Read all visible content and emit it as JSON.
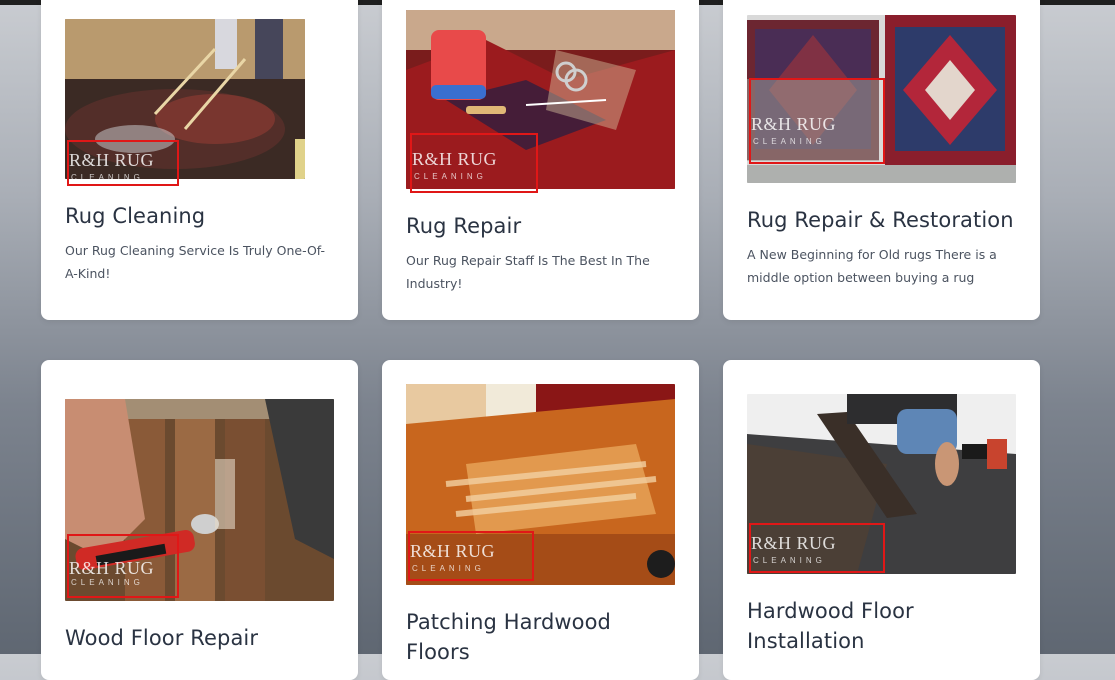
{
  "watermark": {
    "brand": "R&H RUG",
    "sub": "CLEANING"
  },
  "cards": [
    {
      "title": "Rug Cleaning",
      "description": "Our Rug Cleaning Service Is Truly One-Of-A-Kind!"
    },
    {
      "title": "Rug Repair",
      "description": "Our Rug Repair Staff Is The Best In The Industry!"
    },
    {
      "title": "Rug Repair & Restoration",
      "description": "A New Beginning for Old rugs There is a middle option between buying a rug"
    },
    {
      "title": "Wood Floor Repair",
      "description": ""
    },
    {
      "title": "Patching Hardwood Floors",
      "description": ""
    },
    {
      "title": "Hardwood Floor Installation",
      "description": ""
    }
  ],
  "colors": {
    "highlight_box": "#e01717",
    "title_text": "#2a3342",
    "body_text": "#4b5360"
  }
}
